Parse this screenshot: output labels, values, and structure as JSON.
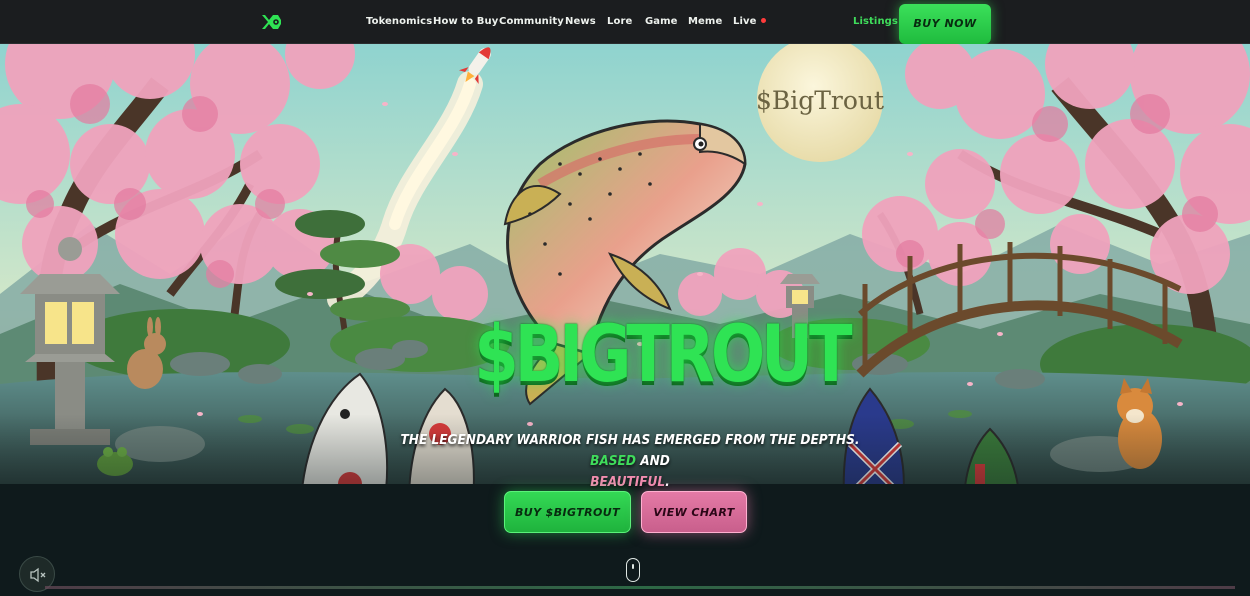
{
  "nav": {
    "logo_icon": "fish-logo-icon",
    "links": [
      "Tokenomics",
      "How to Buy",
      "Community",
      "News",
      "Lore",
      "Game",
      "Meme",
      "Live"
    ],
    "listings": "Listings",
    "buy_now": "BUY NOW"
  },
  "hero": {
    "moon_text": "$BigTrout",
    "title": "$BIGTROUT",
    "tagline_part1": "THE LEGENDARY WARRIOR FISH HAS EMERGED FROM THE DEPTHS.",
    "tagline_based": "BASED",
    "tagline_and": "AND",
    "tagline_beautiful": "BEAUTIFUL",
    "tagline_end": ".",
    "buy_button": "BUY $BIGTROUT",
    "chart_button": "VIEW CHART"
  },
  "controls": {
    "mute_icon": "speaker-muted-icon",
    "scroll_icon": "scroll-mouse-icon"
  },
  "colors": {
    "accent_green": "#3fdc5b",
    "accent_pink": "#e47aa6",
    "navbar_bg": "#1b1d1f",
    "live_dot": "#ff3b3b"
  }
}
